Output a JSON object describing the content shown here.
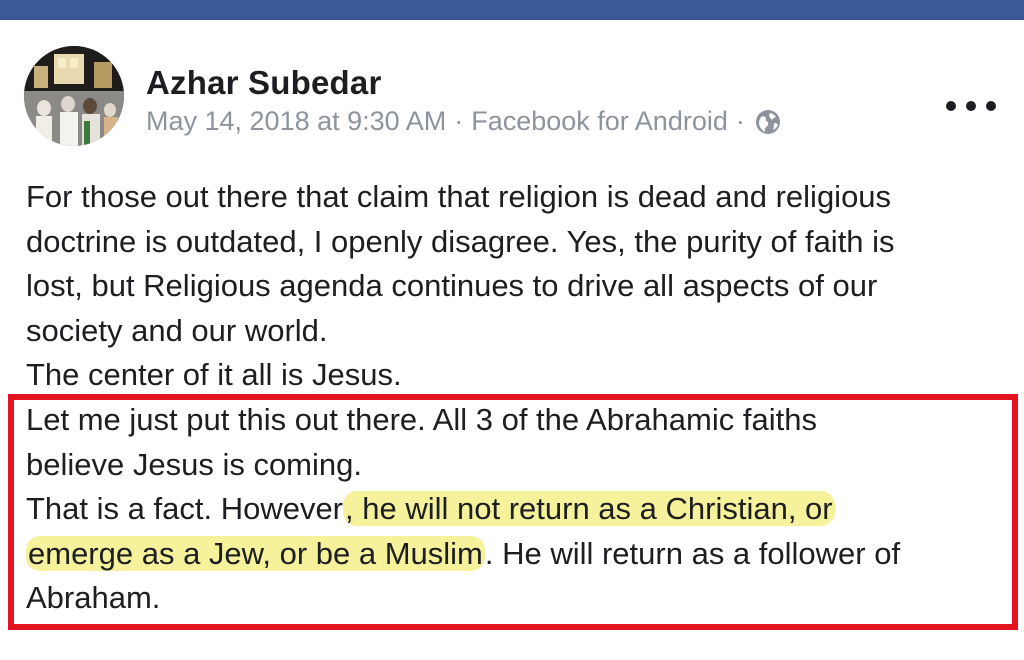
{
  "post": {
    "author": "Azhar Subedar",
    "timestamp": "May 14, 2018 at 9:30 AM",
    "separator": "·",
    "source": "Facebook for Android",
    "privacy_icon": "globe-icon",
    "menu_icon": "more-options-icon",
    "body_lines": [
      "For those out there that claim that religion is dead and religious",
      "doctrine is outdated, I openly disagree. Yes, the purity of faith is",
      "lost, but Religious agenda continues to drive all aspects of our",
      "society and our world.",
      "The center of it all is Jesus.",
      "Let me just put this out there. All 3 of the Abrahamic faiths",
      "believe Jesus is coming."
    ],
    "line8_pre": "That is a fact. However",
    "line8_hl": ", he will not return as a Christian, or",
    "line9_hl": "emerge as a Jew, or be a Muslim",
    "line9_post": ". He will return as a follower of",
    "line10": "Abraham."
  },
  "colors": {
    "header_bar": "#3b5998",
    "highlight": "#f6f29c",
    "annotation_box": "#e3131f",
    "meta_text": "#8d949e"
  }
}
